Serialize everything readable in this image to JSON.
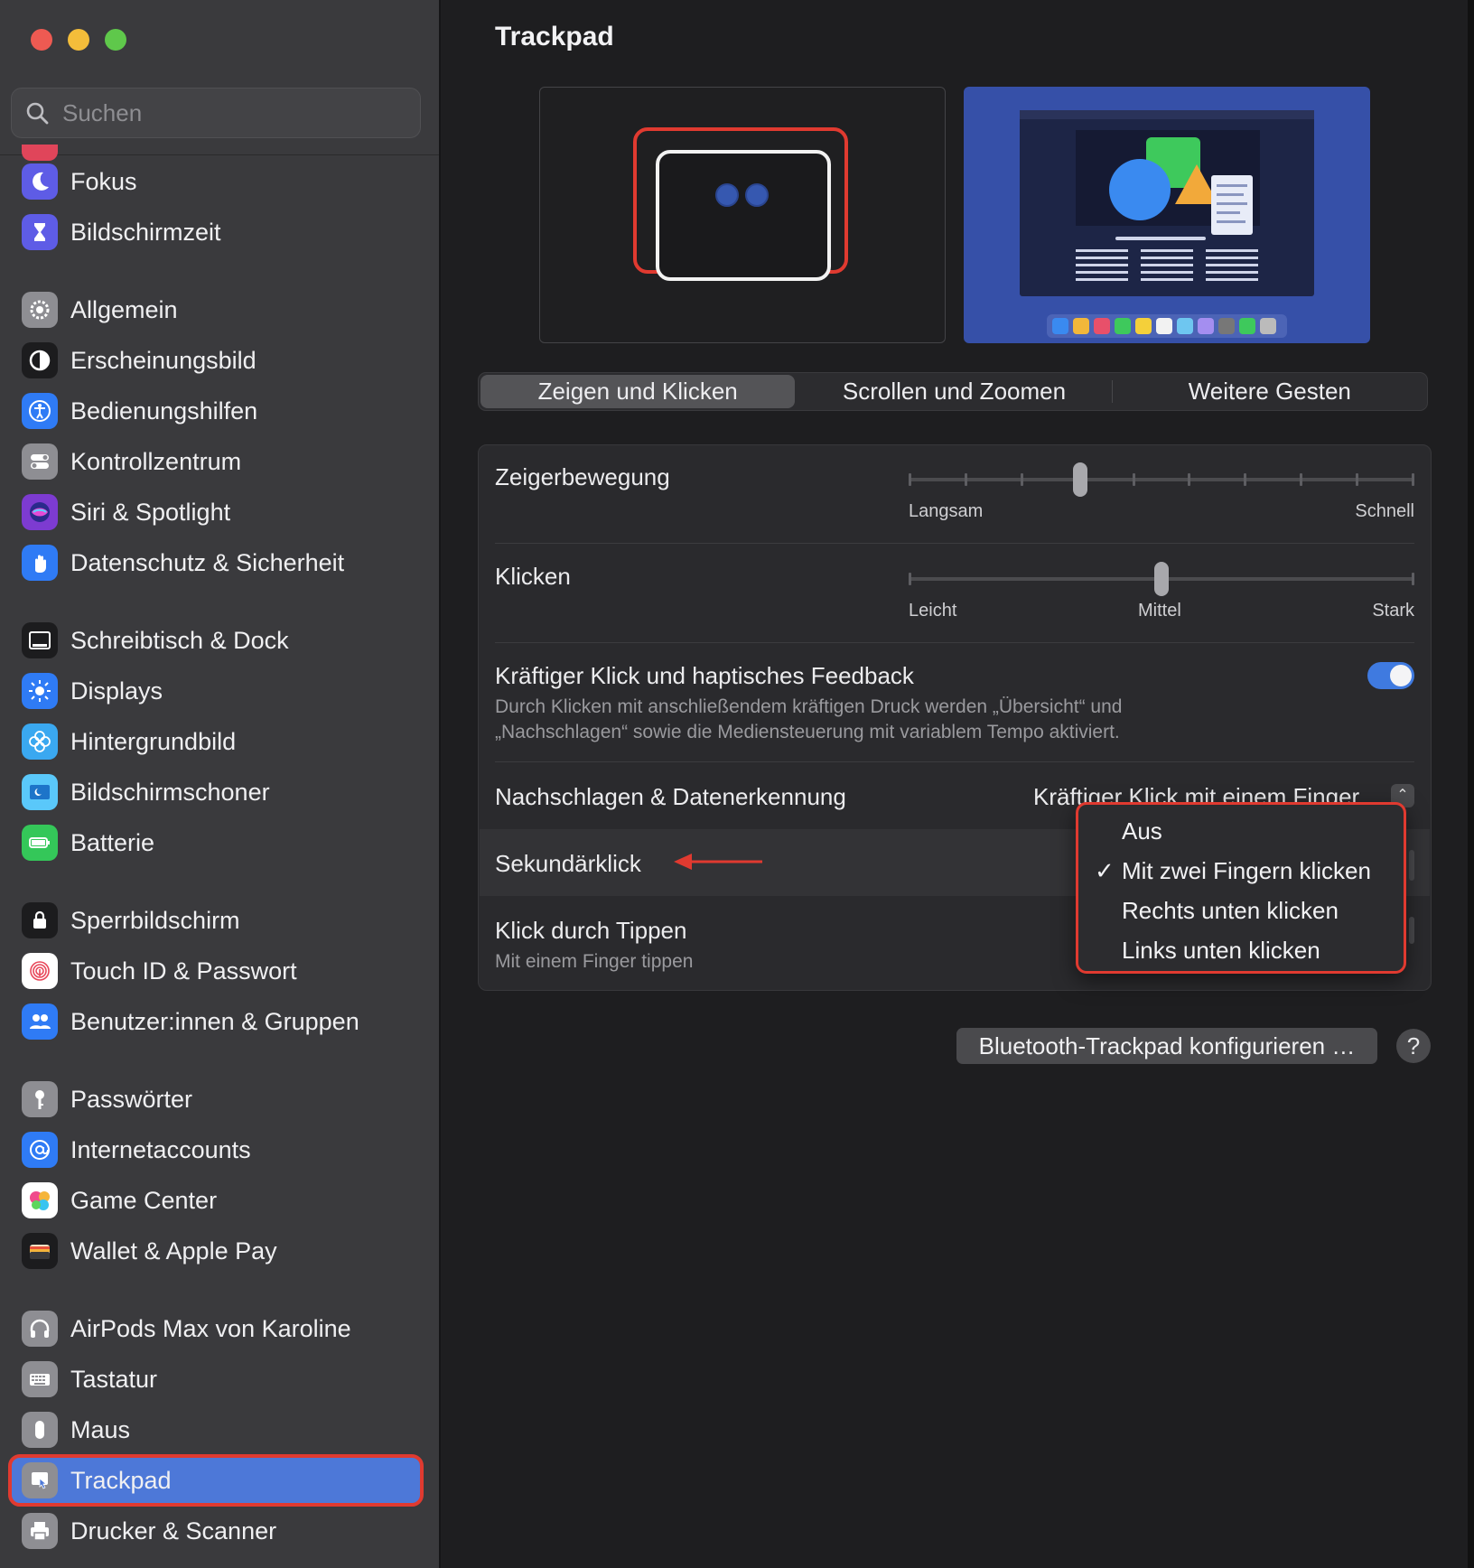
{
  "window": {
    "title": "Trackpad"
  },
  "search": {
    "placeholder": "Suchen"
  },
  "sidebar": {
    "items": [
      {
        "label": "Fokus",
        "icon": "moon-icon",
        "color": "#5e5ce6"
      },
      {
        "label": "Bildschirmzeit",
        "icon": "hourglass-icon",
        "color": "#5e5ce6"
      },
      {
        "label": "Allgemein",
        "icon": "gear-icon",
        "color": "#8e8e93"
      },
      {
        "label": "Erscheinungsbild",
        "icon": "appearance-icon",
        "color": "#1c1c1e"
      },
      {
        "label": "Bedienungshilfen",
        "icon": "accessibility-icon",
        "color": "#2f7bf5"
      },
      {
        "label": "Kontrollzentrum",
        "icon": "toggles-icon",
        "color": "#8e8e93"
      },
      {
        "label": "Siri & Spotlight",
        "icon": "siri-icon",
        "color": "#7d3bd1"
      },
      {
        "label": "Datenschutz & Sicherheit",
        "icon": "hand-icon",
        "color": "#2f7bf5"
      },
      {
        "label": "Schreibtisch & Dock",
        "icon": "dock-icon",
        "color": "#1c1c1e"
      },
      {
        "label": "Displays",
        "icon": "sun-icon",
        "color": "#2f7bf5"
      },
      {
        "label": "Hintergrundbild",
        "icon": "flower-icon",
        "color": "#3aa8f0"
      },
      {
        "label": "Bildschirmschoner",
        "icon": "screensaver-icon",
        "color": "#5ac8fa"
      },
      {
        "label": "Batterie",
        "icon": "battery-icon",
        "color": "#34c759"
      },
      {
        "label": "Sperrbildschirm",
        "icon": "lock-icon",
        "color": "#1c1c1e"
      },
      {
        "label": "Touch ID & Passwort",
        "icon": "fingerprint-icon",
        "color": "#ffffff"
      },
      {
        "label": "Benutzer:innen & Gruppen",
        "icon": "users-icon",
        "color": "#2f7bf5"
      },
      {
        "label": "Passwörter",
        "icon": "key-icon",
        "color": "#8e8e93"
      },
      {
        "label": "Internetaccounts",
        "icon": "at-icon",
        "color": "#2f7bf5"
      },
      {
        "label": "Game Center",
        "icon": "game-center-icon",
        "color": "#ffffff"
      },
      {
        "label": "Wallet & Apple Pay",
        "icon": "wallet-icon",
        "color": "#1c1c1e"
      },
      {
        "label": "AirPods Max von Karoline",
        "icon": "headphones-icon",
        "color": "#8e8e93"
      },
      {
        "label": "Tastatur",
        "icon": "keyboard-icon",
        "color": "#8e8e93"
      },
      {
        "label": "Maus",
        "icon": "mouse-icon",
        "color": "#8e8e93"
      },
      {
        "label": "Trackpad",
        "icon": "trackpad-icon",
        "color": "#8e8e93",
        "selected": true
      },
      {
        "label": "Drucker & Scanner",
        "icon": "printer-icon",
        "color": "#8e8e93"
      }
    ]
  },
  "tabs": [
    {
      "label": "Zeigen und Klicken",
      "active": true
    },
    {
      "label": "Scrollen und Zoomen"
    },
    {
      "label": "Weitere Gesten"
    }
  ],
  "settings": {
    "pointer_speed": {
      "label": "Zeigerbewegung",
      "min_label": "Langsam",
      "max_label": "Schnell",
      "value_fraction": 0.34
    },
    "click": {
      "label": "Klicken",
      "min_label": "Leicht",
      "mid_label": "Mittel",
      "max_label": "Stark",
      "value_fraction": 0.5
    },
    "force_click": {
      "label": "Kräftiger Klick und haptisches Feedback",
      "description_line1": "Durch Klicken mit anschließendem kräftigen Druck werden „Übersicht“ und",
      "description_line2": "„Nachschlagen“ sowie die Mediensteuerung mit variablem Tempo aktiviert.",
      "enabled": true
    },
    "lookup": {
      "label": "Nachschlagen & Datenerkennung",
      "value": "Kräftiger Klick mit einem Finger"
    },
    "secondary_click": {
      "label": "Sekundärklick"
    },
    "tap_to_click": {
      "label": "Klick durch Tippen",
      "sub": "Mit einem Finger tippen"
    }
  },
  "popup": {
    "options": [
      "Aus",
      "Mit zwei Fingern klicken",
      "Rechts unten klicken",
      "Links unten klicken"
    ],
    "selected": "Mit zwei Fingern klicken",
    "check": "✓"
  },
  "footer": {
    "bt_button": "Bluetooth-Trackpad konfigurieren …",
    "help": "?"
  },
  "colors": {
    "accent": "#3f7ae0",
    "annotation": "#e03a30"
  }
}
